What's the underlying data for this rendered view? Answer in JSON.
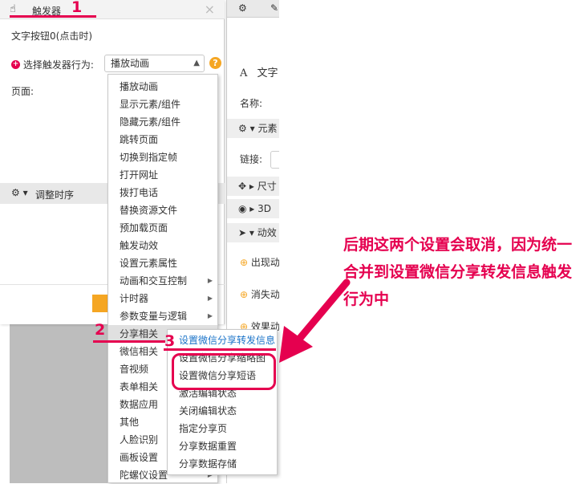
{
  "colors": {
    "annotation": "#e5004f",
    "accent_orange": "#f5a623",
    "link_blue": "#1a73c8"
  },
  "dialog": {
    "title": "触发器",
    "close_icon": "×",
    "button_name": "文字按钮0(点击时)",
    "trigger_label": "选择触发器行为:",
    "trigger_value": "播放动画",
    "help_icon": "?",
    "page_label": "页面:",
    "timing_label": "调整时序"
  },
  "trigger_menu": {
    "items": [
      {
        "label": "播放动画",
        "has_sub": false
      },
      {
        "label": "显示元素/组件",
        "has_sub": false
      },
      {
        "label": "隐藏元素/组件",
        "has_sub": false
      },
      {
        "label": "跳转页面",
        "has_sub": false
      },
      {
        "label": "切换到指定帧",
        "has_sub": false
      },
      {
        "label": "打开网址",
        "has_sub": false
      },
      {
        "label": "拨打电话",
        "has_sub": false
      },
      {
        "label": "替换资源文件",
        "has_sub": false
      },
      {
        "label": "预加载页面",
        "has_sub": false
      },
      {
        "label": "触发动效",
        "has_sub": false
      },
      {
        "label": "设置元素属性",
        "has_sub": false
      },
      {
        "label": "动画和交互控制",
        "has_sub": true
      },
      {
        "label": "计时器",
        "has_sub": true
      },
      {
        "label": "参数变量与逻辑",
        "has_sub": true
      },
      {
        "label": "分享相关",
        "has_sub": true
      },
      {
        "label": "微信相关",
        "has_sub": true
      },
      {
        "label": "音视频",
        "has_sub": true
      },
      {
        "label": "表单相关",
        "has_sub": true
      },
      {
        "label": "数据应用",
        "has_sub": true
      },
      {
        "label": "其他",
        "has_sub": true
      },
      {
        "label": "人脸识别",
        "has_sub": true
      },
      {
        "label": "画板设置",
        "has_sub": true
      },
      {
        "label": "陀螺仪设置",
        "has_sub": true
      }
    ]
  },
  "share_menu": {
    "items": [
      "设置微信分享转发信息",
      "设置微信分享缩略图",
      "设置微信分享短语",
      "激活编辑状态",
      "关闭编辑状态",
      "指定分享页",
      "分享数据重置",
      "分享数据存储"
    ]
  },
  "side_panel": {
    "text_label": "文字",
    "name_label": "名称:",
    "element_section": "元素",
    "link_label": "链接:",
    "size_section": "尺寸",
    "threed_section": "3D",
    "anim_section": "动效",
    "appear_label": "出现动",
    "disappear_label": "消失动",
    "emphasis_label": "效果动"
  },
  "annotations": {
    "num1": "1",
    "num2": "2",
    "num3": "3",
    "note": "后期这两个设置会取消，因为统一合并到设置微信分享转发信息触发行为中"
  }
}
